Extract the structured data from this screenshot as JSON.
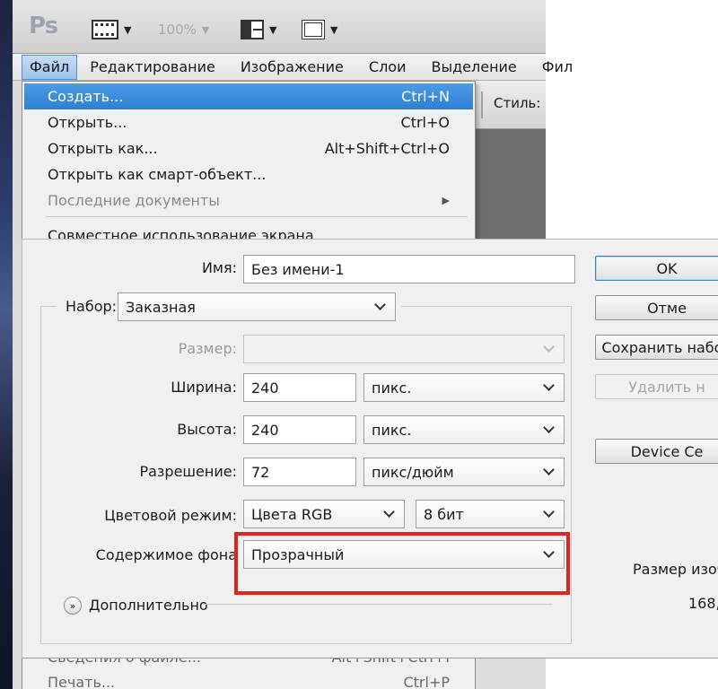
{
  "toolbar": {
    "logo": "Ps",
    "zoom": "100%"
  },
  "menubar": {
    "items": [
      "Файл",
      "Редактирование",
      "Изображение",
      "Слои",
      "Выделение",
      "Фил"
    ]
  },
  "options": {
    "style_label": "Стиль:"
  },
  "file_menu": {
    "items": [
      {
        "label": "Создать...",
        "shortcut": "Ctrl+N"
      },
      {
        "label": "Открыть...",
        "shortcut": "Ctrl+O"
      },
      {
        "label": "Открыть как...",
        "shortcut": "Alt+Shift+Ctrl+O"
      },
      {
        "label": "Открыть как смарт-объект...",
        "shortcut": ""
      },
      {
        "label": "Последние документы",
        "shortcut": ""
      },
      {
        "label": "Совместное использование экрана...",
        "shortcut": ""
      }
    ],
    "tail_items": [
      {
        "label": "Сведения о файле...",
        "shortcut": "Alt+Shift+Ctrl+I"
      },
      {
        "label": "Печать...",
        "shortcut": "Ctrl+P"
      }
    ]
  },
  "dialog": {
    "name_label": "Имя:",
    "name_value": "Без имени-1",
    "preset_label": "Набор:",
    "preset_value": "Заказная",
    "size_label": "Размер:",
    "size_value": "",
    "width_label": "Ширина:",
    "width_value": "240",
    "width_unit": "пикс.",
    "height_label": "Высота:",
    "height_value": "240",
    "height_unit": "пикс.",
    "resolution_label": "Разрешение:",
    "resolution_value": "72",
    "resolution_unit": "пикс/дюйм",
    "color_mode_label": "Цветовой режим:",
    "color_mode_value": "Цвета RGB",
    "bit_depth_value": "8 бит",
    "background_label": "Содержимое фона",
    "background_value": "Прозрачный",
    "advanced_label": "Дополнительно",
    "buttons": {
      "ok": "OK",
      "cancel": "Отме",
      "save_preset": "Сохранить набор",
      "delete_preset": "Удалить н",
      "device_central": "Device Ce"
    },
    "image_size_label": "Размер изобр",
    "image_size_value": "168,8"
  },
  "colors": {
    "highlight": "#e02424",
    "menu_selection": "#2f7fd4"
  }
}
